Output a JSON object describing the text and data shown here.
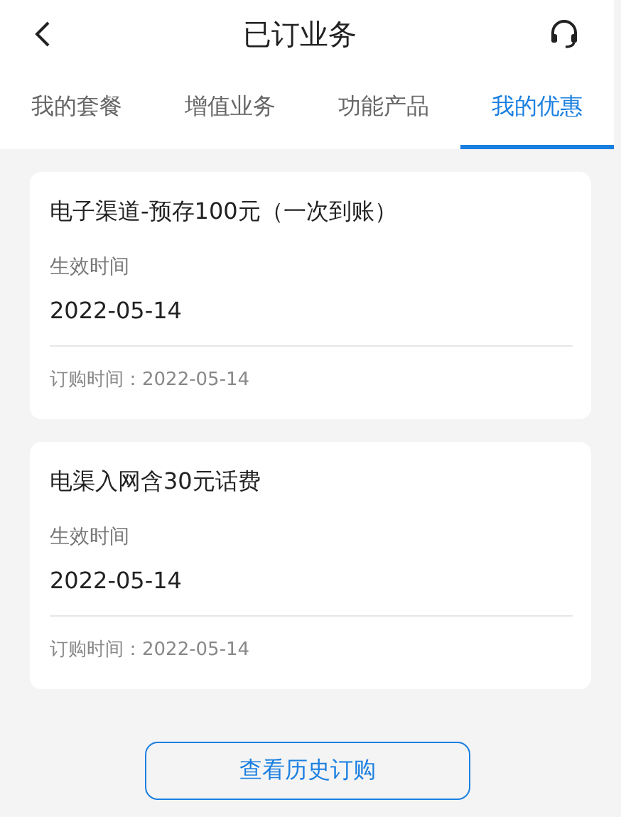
{
  "header": {
    "title": "已订业务"
  },
  "tabs": [
    {
      "label": "我的套餐",
      "selected": false
    },
    {
      "label": "增值业务",
      "selected": false
    },
    {
      "label": "功能产品",
      "selected": false
    },
    {
      "label": "我的优惠",
      "selected": true
    }
  ],
  "offers": [
    {
      "name": "电子渠道-预存100元（一次到账）",
      "effective_label": "生效时间",
      "effective_date": "2022-05-14",
      "order_time": "订购时间：2022-05-14"
    },
    {
      "name": "电渠入网含30元话费",
      "effective_label": "生效时间",
      "effective_date": "2022-05-14",
      "order_time": "订购时间：2022-05-14"
    }
  ],
  "history_button": "查看历史订购"
}
